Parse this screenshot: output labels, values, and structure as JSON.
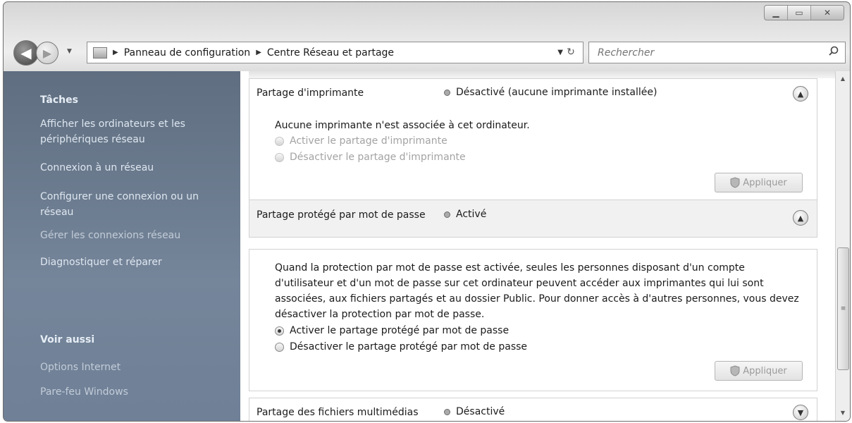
{
  "window": {
    "buttons": {
      "minimize": "▁",
      "maximize": "▭",
      "close": "✕"
    }
  },
  "nav": {
    "breadcrumb": [
      "Panneau de configuration",
      "Centre Réseau et partage"
    ],
    "search_placeholder": "Rechercher"
  },
  "sidebar": {
    "tasks_title": "Tâches",
    "tasks": [
      "Afficher les ordinateurs et les périphériques réseau",
      "Connexion à un réseau",
      "Configurer une connexion ou un réseau",
      "Gérer les connexions réseau",
      "Diagnostiquer et réparer"
    ],
    "see_also_title": "Voir aussi",
    "see_also": [
      "Options Internet",
      "Pare-feu Windows"
    ]
  },
  "sections": {
    "printer": {
      "title": "Partage d'imprimante",
      "status": "Désactivé (aucune imprimante installée)",
      "description": "Aucune imprimante n'est associée à cet ordinateur.",
      "options": [
        "Activer le partage d'imprimante",
        "Désactiver le partage d'imprimante"
      ],
      "apply": "Appliquer"
    },
    "password": {
      "title": "Partage protégé par mot de passe",
      "status": "Activé",
      "description": "Quand la protection par mot de passe est activée, seules les personnes disposant d'un compte d'utilisateur et d'un mot de passe sur cet ordinateur peuvent accéder aux imprimantes qui lui sont associées, aux fichiers partagés et au dossier Public. Pour donner accès à d'autres personnes, vous devez désactiver la protection par mot de passe.",
      "options": [
        "Activer le partage protégé par mot de passe",
        "Désactiver le partage protégé par mot de passe"
      ],
      "selected": "Activer le partage protégé par mot de passe",
      "apply": "Appliquer"
    },
    "media": {
      "title": "Partage des fichiers multimédias",
      "status": "Désactivé"
    }
  }
}
